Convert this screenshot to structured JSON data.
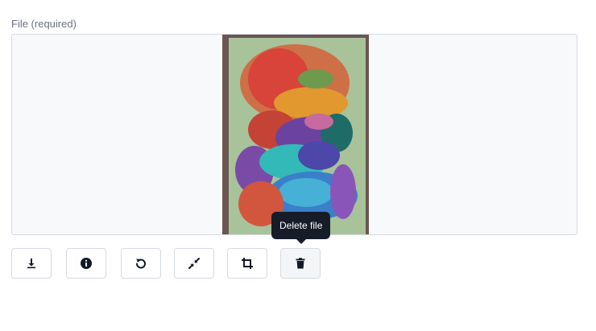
{
  "field": {
    "label": "File (required)"
  },
  "preview": {
    "image_icon": "watercolor-painting"
  },
  "toolbar": {
    "buttons": [
      {
        "name": "download-button",
        "icon": "download-icon"
      },
      {
        "name": "info-button",
        "icon": "info-icon"
      },
      {
        "name": "rotate-button",
        "icon": "rotate-left-icon"
      },
      {
        "name": "collapse-button",
        "icon": "compress-icon"
      },
      {
        "name": "crop-button",
        "icon": "crop-icon"
      },
      {
        "name": "delete-button",
        "icon": "trash-icon"
      }
    ]
  },
  "tooltip": {
    "text": "Delete file"
  },
  "colors": {
    "border": "#d4dbe3",
    "label": "#6b7280",
    "tooltip_bg": "#161d29",
    "icon": "#111827"
  }
}
